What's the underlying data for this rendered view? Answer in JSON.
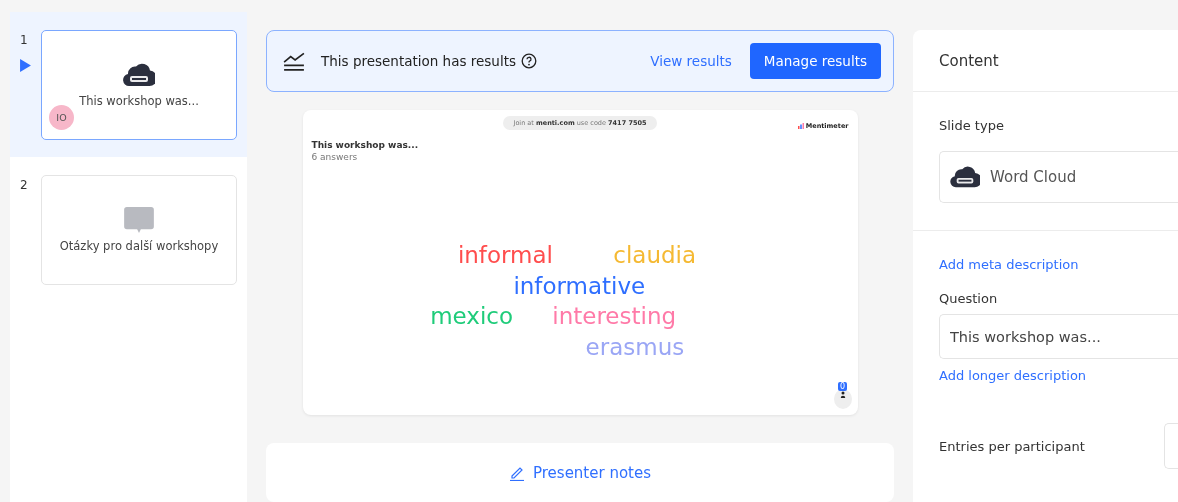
{
  "slides": [
    {
      "number": "1",
      "title": "This workshop was...",
      "kind": "wordcloud",
      "selected": true,
      "badge": "IO"
    },
    {
      "number": "2",
      "title": "Otázky pro další workshopy",
      "kind": "open",
      "selected": false
    }
  ],
  "results_banner": {
    "text": "This presentation has results",
    "link": "View results",
    "button": "Manage results"
  },
  "preview": {
    "join_prefix": "Join at",
    "join_site": "menti.com",
    "code_prefix": "use code",
    "code": "7417 7505",
    "brand": "Mentimeter",
    "title": "This workshop was...",
    "answers": "6 answers",
    "participants": "0",
    "words": [
      {
        "text": "informal",
        "color": "#ff4d4d"
      },
      {
        "text": "claudia",
        "color": "#f5b932"
      },
      {
        "text": "informative",
        "color": "#2f6fff"
      },
      {
        "text": "mexico",
        "color": "#1fcc7a"
      },
      {
        "text": "interesting",
        "color": "#ff7aa8"
      },
      {
        "text": "erasmus",
        "color": "#9aa6f5"
      }
    ]
  },
  "presenter_notes": "Presenter notes",
  "panel": {
    "title": "Content",
    "slide_type_label": "Slide type",
    "slide_type": "Word Cloud",
    "meta_link": "Add meta description",
    "question_label": "Question",
    "question": "This workshop was...",
    "longer_link": "Add longer description",
    "entries_label": "Entries per participant"
  }
}
